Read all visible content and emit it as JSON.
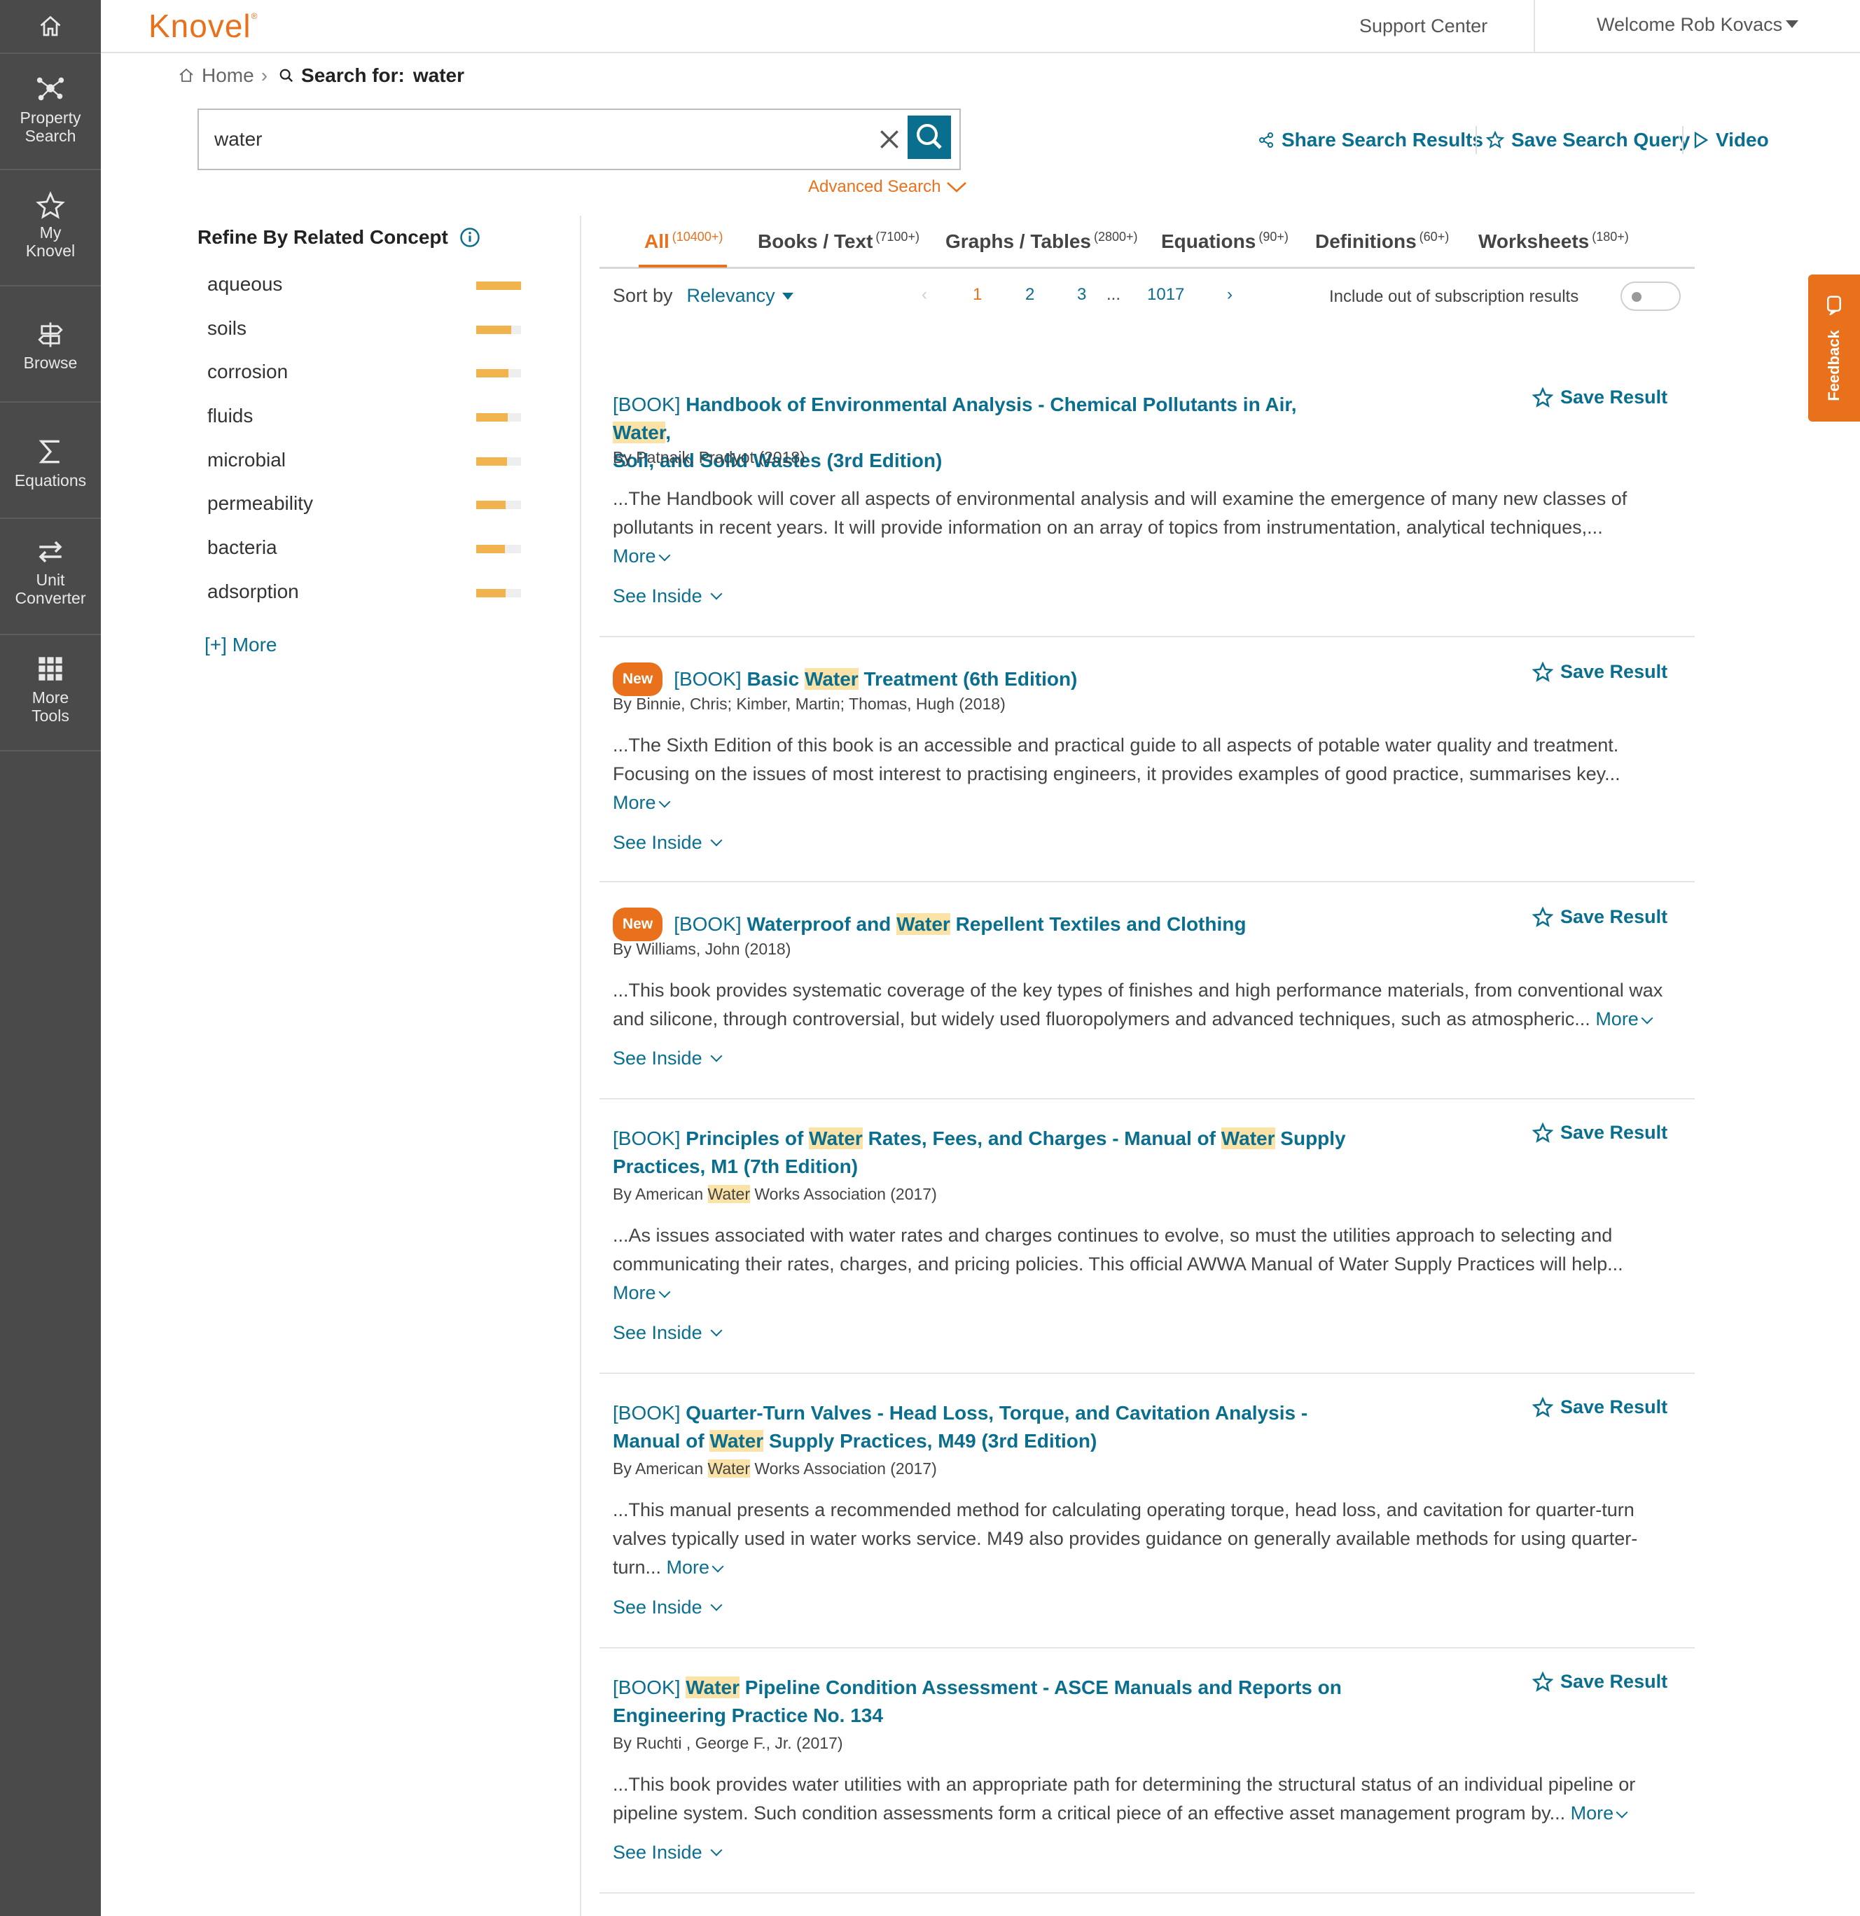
{
  "sidebar": {
    "items": [
      {
        "label_1": "Property",
        "label_2": "Search",
        "icon": "molecule-icon"
      },
      {
        "label_1": "My",
        "label_2": "Knovel",
        "icon": "star-icon"
      },
      {
        "label_1": "Browse",
        "label_2": "",
        "icon": "signpost-icon"
      },
      {
        "label_1": "Equations",
        "label_2": "",
        "icon": "sigma-icon"
      },
      {
        "label_1": "Unit",
        "label_2": "Converter",
        "icon": "swap-arrows-icon"
      },
      {
        "label_1": "More",
        "label_2": "Tools",
        "icon": "grid-icon"
      }
    ]
  },
  "header": {
    "logo": "Knovel",
    "support": "Support Center",
    "welcome": "Welcome Rob Kovacs"
  },
  "breadcrumb": {
    "home": "Home",
    "search_for": "Search for:",
    "query": "water"
  },
  "search": {
    "value": "water",
    "advanced": "Advanced Search"
  },
  "actions": {
    "share": "Share Search Results",
    "save_query": "Save Search Query",
    "video": "Video"
  },
  "feedback": "Feedback",
  "refine": {
    "title": "Refine By Related Concept",
    "more": "[+] More",
    "items": [
      {
        "name": "aqueous",
        "weight": 1.0
      },
      {
        "name": "soils",
        "weight": 0.78
      },
      {
        "name": "corrosion",
        "weight": 0.72
      },
      {
        "name": "fluids",
        "weight": 0.7
      },
      {
        "name": "microbial",
        "weight": 0.68
      },
      {
        "name": "permeability",
        "weight": 0.66
      },
      {
        "name": "bacteria",
        "weight": 0.64
      },
      {
        "name": "adsorption",
        "weight": 0.66
      }
    ]
  },
  "tabs": [
    {
      "label": "All",
      "count": "(10400+)"
    },
    {
      "label": "Books / Text",
      "count": "(7100+)"
    },
    {
      "label": "Graphs / Tables",
      "count": "(2800+)"
    },
    {
      "label": "Equations",
      "count": "(90+)"
    },
    {
      "label": "Definitions",
      "count": "(60+)"
    },
    {
      "label": "Worksheets",
      "count": "(180+)"
    }
  ],
  "sort": {
    "label": "Sort by",
    "value": "Relevancy"
  },
  "pagination": {
    "pages": [
      "1",
      "2",
      "3"
    ],
    "ellipsis": "...",
    "last": "1017"
  },
  "include_out": "Include out of subscription results",
  "labels": {
    "save_result": "Save Result",
    "see_inside": "See Inside",
    "more": "More",
    "new": "New",
    "book": "[BOOK]"
  },
  "results": [
    {
      "title_parts": [
        "Handbook of Environmental Analysis - Chemical Pollutants in Air, ",
        "Water",
        ",",
        "Soil, and Solid Wastes (3rd Edition)"
      ],
      "author": "By Patnaik, Pradyot (2018)",
      "desc_1": "...The Handbook will cover all aspects of environmental analysis and will examine the emergence of many new classes of",
      "desc_2": "pollutants in recent years. It will provide information on an array of topics from instrumentation, analytical techniques,..."
    },
    {
      "title_parts": [
        "Basic ",
        "Water",
        " Treatment (6th Edition)"
      ],
      "author": "By Binnie, Chris; Kimber, Martin; Thomas, Hugh (2018)",
      "desc_1": "...The Sixth Edition of this book is an accessible and practical guide to all aspects of potable water quality and treatment.",
      "desc_2": "Focusing on the issues of most interest to practising engineers, it provides examples of good practice, summarises key..."
    },
    {
      "title_parts": [
        "Waterproof and ",
        "Water",
        " Repellent Textiles and Clothing"
      ],
      "author": "By Williams, John (2018)",
      "desc_1": "...This book provides systematic coverage of the key types of finishes and high performance materials, from conventional wax",
      "desc_2": "and silicone, through controversial, but widely used fluoropolymers and advanced techniques, such as atmospheric..."
    },
    {
      "title_parts": [
        "Principles of ",
        "Water",
        " Rates, Fees, and Charges - Manual of ",
        "Water",
        " Supply",
        "Practices, M1 (7th Edition)"
      ],
      "author_parts": [
        "By American ",
        "Water",
        " Works Association (2017)"
      ],
      "desc_1": "...As issues associated with water rates and charges continues to evolve, so must the utilities approach to selecting and",
      "desc_2": "communicating their rates, charges, and pricing policies. This official AWWA Manual of Water Supply Practices will help..."
    },
    {
      "title_parts": [
        "Quarter-Turn Valves - Head Loss, Torque, and Cavitation Analysis -",
        "Manual of ",
        "Water",
        " Supply Practices, M49 (3rd Edition)"
      ],
      "author_parts": [
        "By American ",
        "Water",
        " Works Association (2017)"
      ],
      "desc_1": "...This manual presents a recommended method for calculating operating torque, head loss, and cavitation for quarter-turn",
      "desc_2": "valves typically used in water works service. M49 also provides guidance on generally available methods for using quarter-",
      "desc_3": "turn..."
    },
    {
      "title_parts": [
        "Water",
        " Pipeline Condition Assessment - ASCE Manuals and Reports on",
        "Engineering Practice No. 134"
      ],
      "author": "By Ruchti , George F., Jr. (2017)",
      "desc_1": "...This book provides water utilities with an appropriate path for determining the structural status of an individual pipeline or",
      "desc_2": "pipeline system. Such condition assessments form a critical piece of an effective asset management program by..."
    }
  ],
  "colors": {
    "accent": "#e9711c",
    "link": "#0a6e8e",
    "sidebar": "#4a4a4a",
    "highlight": "#fbe2a7",
    "bar": "#f0b34e"
  }
}
